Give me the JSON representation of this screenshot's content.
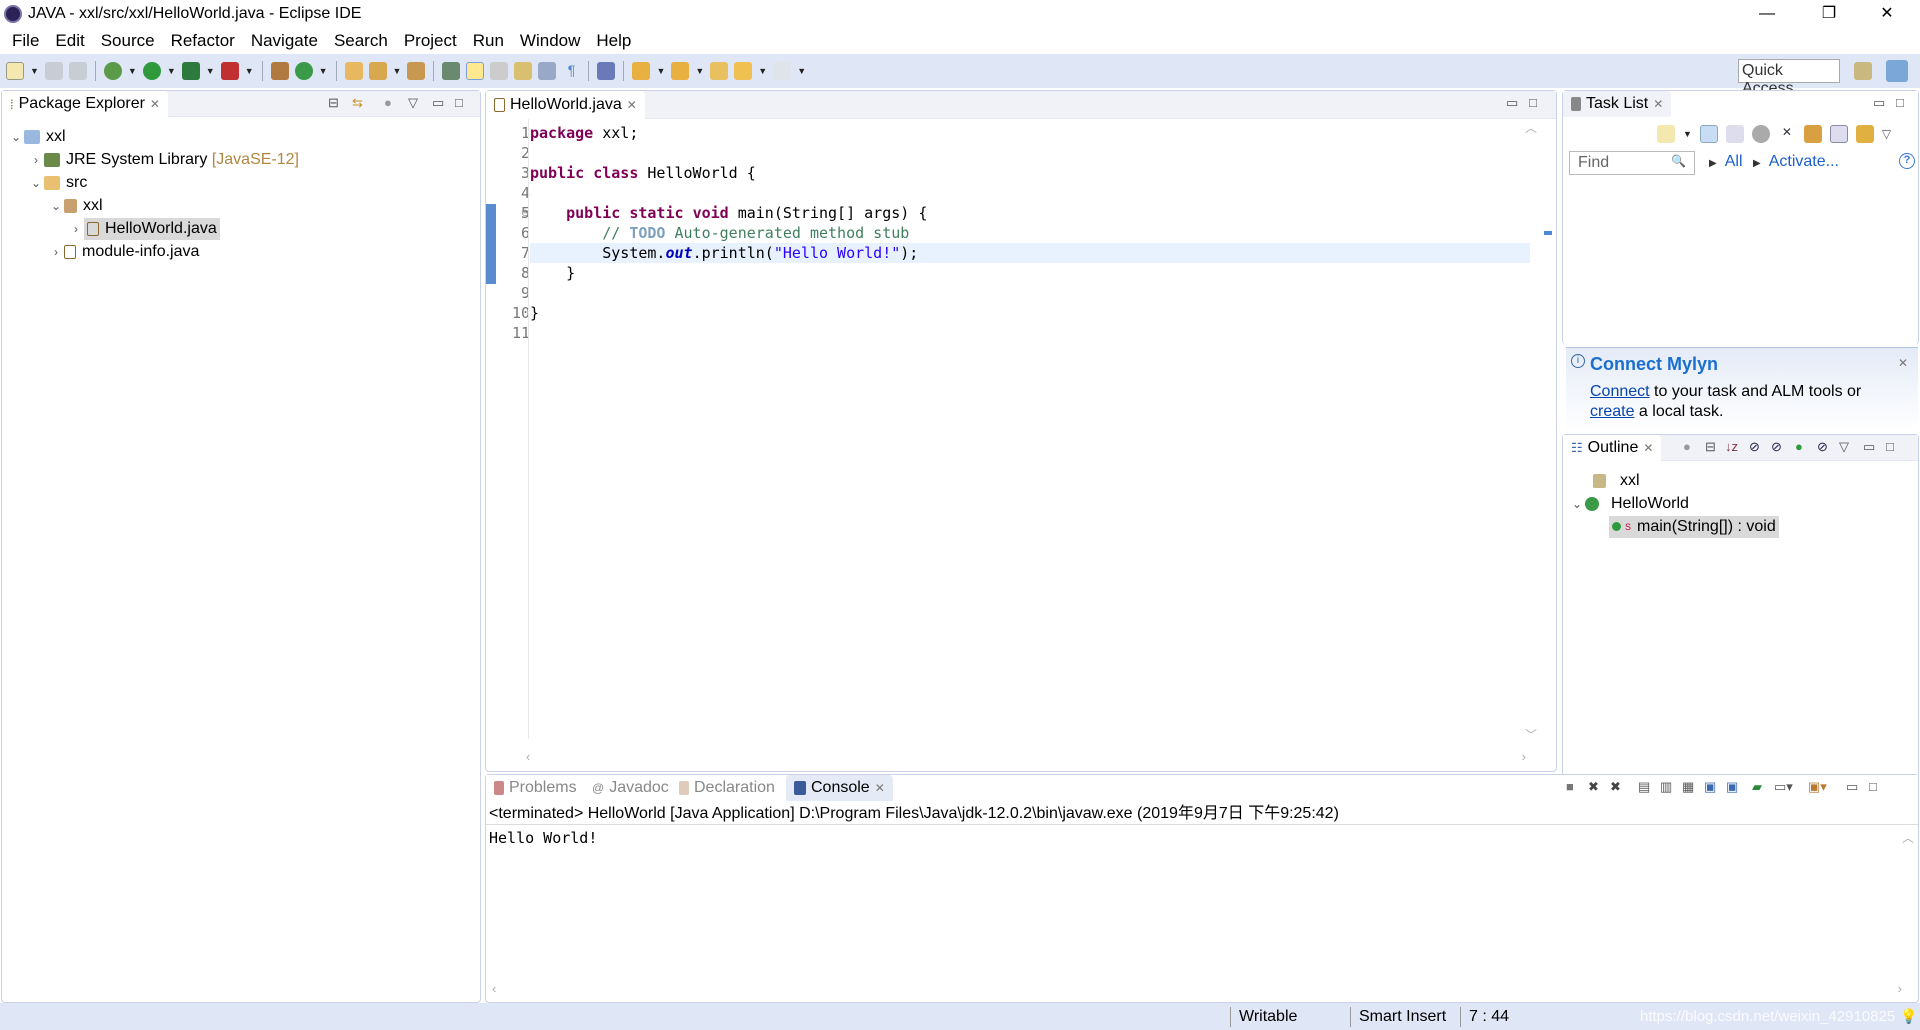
{
  "window": {
    "title": "JAVA - xxl/src/xxl/HelloWorld.java - Eclipse IDE",
    "minimize": "—",
    "restore": "❐",
    "close": "✕"
  },
  "menu": [
    "File",
    "Edit",
    "Source",
    "Refactor",
    "Navigate",
    "Search",
    "Project",
    "Run",
    "Window",
    "Help"
  ],
  "toolbar": {
    "quick_access": "Quick Access",
    "icons": [
      "new-icon",
      "save-icon",
      "save-all-icon",
      "debug-icon",
      "run-icon",
      "coverage-icon",
      "external-tools-icon",
      "new-java-project-icon",
      "new-class-icon",
      "open-type-icon",
      "search-icon",
      "open-task-icon",
      "toggle-breadcrumb-icon",
      "mark-occurrences-icon",
      "block-selection-icon",
      "show-whitespace-icon",
      "next-annotation-icon",
      "prev-annotation-icon",
      "last-edit-icon",
      "back-icon",
      "forward-icon"
    ]
  },
  "package_explorer": {
    "title": "Package Explorer",
    "tree": [
      {
        "label": "xxl",
        "depth": 0,
        "expanded": true
      },
      {
        "label": "JRE System Library",
        "decoration": "[JavaSE-12]",
        "depth": 1,
        "expanded": false
      },
      {
        "label": "src",
        "depth": 1,
        "expanded": true
      },
      {
        "label": "xxl",
        "depth": 2,
        "expanded": true
      },
      {
        "label": "HelloWorld.java",
        "depth": 3,
        "expanded": false,
        "selected": true
      },
      {
        "label": "module-info.java",
        "depth": 2,
        "expanded": false
      }
    ]
  },
  "editor": {
    "tab": "HelloWorld.java",
    "line_numbers": [
      "1",
      "2",
      "3",
      "4",
      "5",
      "6",
      "7",
      "8",
      "9",
      "10",
      "11"
    ],
    "code": {
      "l1_kw": "package",
      "l1_rest": " xxl;",
      "l3_kw1": "public",
      "l3_kw2": "class",
      "l3_rest": " HelloWorld {",
      "l5_kw1": "public",
      "l5_kw2": "static",
      "l5_kw3": "void",
      "l5_rest": " main(String[] args) {",
      "l6_pre": "// ",
      "l6_todo": "TODO",
      "l6_rest": " Auto-generated method stub",
      "l7_a": "System.",
      "l7_field": "out",
      "l7_b": ".println(",
      "l7_str": "\"Hello World!\"",
      "l7_c": ");",
      "l8": "    }",
      "l10": "}"
    }
  },
  "task_list": {
    "title": "Task List",
    "find_placeholder": "Find",
    "all": "All",
    "activate": "Activate...",
    "help": "?"
  },
  "mylyn": {
    "title": "Connect Mylyn",
    "connect": "Connect",
    "text1": " to your task and ALM tools or",
    "create": "create",
    "text2": " a local task."
  },
  "outline": {
    "title": "Outline",
    "items": [
      {
        "label": "xxl"
      },
      {
        "label": "HelloWorld"
      },
      {
        "label": "main(String[]) : void"
      }
    ]
  },
  "bottom": {
    "tabs": [
      "Problems",
      "Javadoc",
      "Declaration",
      "Console"
    ],
    "active": "Console",
    "console_header": "<terminated> HelloWorld [Java Application] D:\\Program Files\\Java\\jdk-12.0.2\\bin\\javaw.exe (2019年9月7日 下午9:25:42)",
    "output": "Hello World!"
  },
  "status": {
    "writable": "Writable",
    "insert_mode": "Smart Insert",
    "position": "7 : 44",
    "watermark": "https://blog.csdn.net/weixin_42910825"
  }
}
